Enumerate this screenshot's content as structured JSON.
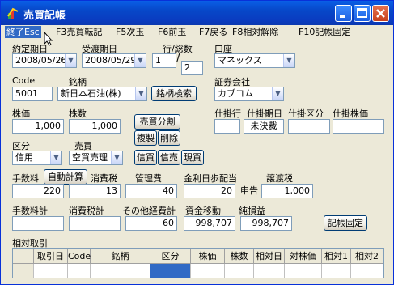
{
  "window": {
    "title": "売買記帳"
  },
  "menu": [
    {
      "label": "終了Esc"
    },
    {
      "label": "F3売買転記"
    },
    {
      "label": "F5次玉"
    },
    {
      "label": "F6前玉"
    },
    {
      "label": "F7戻る"
    },
    {
      "label": "F8相対解除"
    },
    {
      "label": "F10記帳固定"
    }
  ],
  "form": {
    "contract_date_label": "約定期日",
    "contract_date": "2008/05/26",
    "delivery_date_label": "受渡期日",
    "delivery_date": "2008/05/29",
    "row_label": "行/総数",
    "row": "1",
    "row_total": "2",
    "account_label": "口座",
    "account": "マネックス",
    "code_label": "Code",
    "code": "5001",
    "brand_label": "銘柄",
    "brand": "新日本石油(株)",
    "brand_search": "銘柄検索",
    "securities_label": "証券会社",
    "securities": "カブコム",
    "price_label": "株価",
    "price": "1,000",
    "shares_label": "株数",
    "shares": "1,000",
    "split_button": "売買分割",
    "copy_button": "複製",
    "delete_button": "削除",
    "pending_row_label": "仕掛行",
    "pending_date_label": "仕掛期日",
    "pending_class_label": "仕掛区分",
    "pending_price_label": "仕掛株価",
    "pending_date": "未決裁",
    "class_label": "区分",
    "class_value": "信用",
    "trade_label": "売買",
    "trade_value": "空買売理",
    "credit_buy": "信買",
    "credit_sell": "信売",
    "spot_buy": "現買",
    "fee_label": "手数料",
    "auto_calc": "自動計算",
    "fee": "220",
    "tax_label": "消費税",
    "tax": "13",
    "mgmt_label": "管理費",
    "mgmt": "40",
    "interest_label": "金利日歩配当",
    "interest": "20",
    "declare": "申告",
    "transfer_tax_label": "譲渡税",
    "transfer_tax": "1,000",
    "fee_total_label": "手数料計",
    "tax_total_label": "消費税計",
    "other_total_label": "その他経費計",
    "other_total": "60",
    "fund_move_label": "資金移動",
    "fund_move": "998,707",
    "net_profit_label": "純損益",
    "net_profit": "998,707",
    "fix_button": "記帳固定",
    "relative_label": "相対取引"
  },
  "table": {
    "headers": [
      "",
      "取引日",
      "Code",
      "銘柄",
      "区分",
      "株価",
      "株数",
      "相対日",
      "対株価",
      "相対1",
      "相対2"
    ]
  }
}
